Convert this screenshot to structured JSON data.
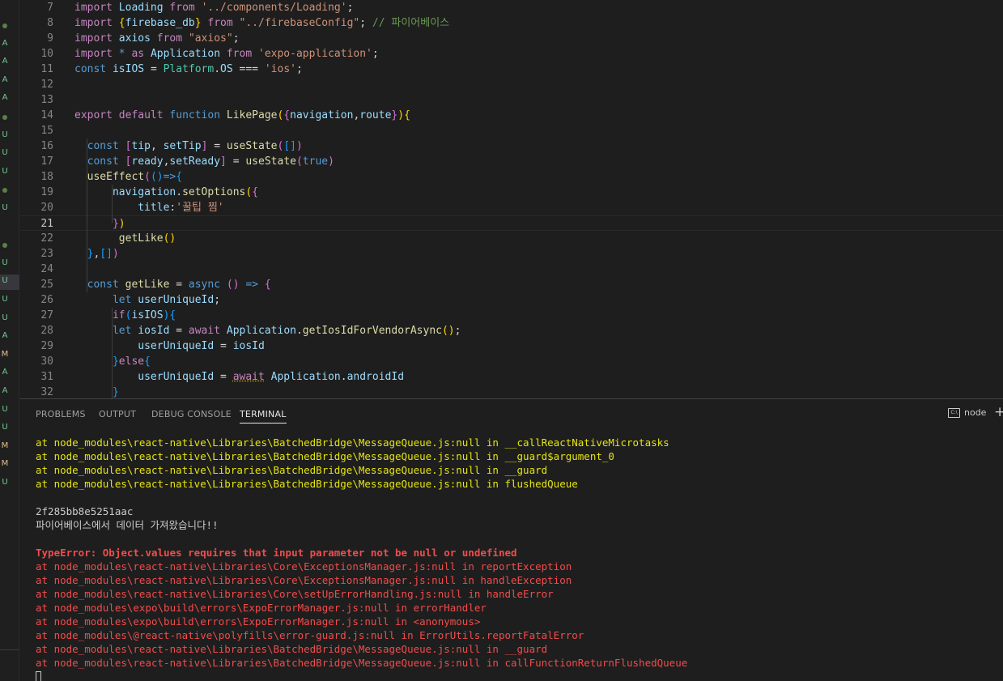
{
  "gutter": {
    "marks": [
      {
        "kind": "dot",
        "label": ""
      },
      {
        "kind": "letter",
        "label": "A"
      },
      {
        "kind": "letter",
        "label": "A"
      },
      {
        "kind": "letter",
        "label": "A"
      },
      {
        "kind": "letter",
        "label": "A"
      },
      {
        "kind": "dot",
        "label": ""
      },
      {
        "kind": "letter",
        "label": "U"
      },
      {
        "kind": "letter",
        "label": "U"
      },
      {
        "kind": "letter",
        "label": "U"
      },
      {
        "kind": "dot",
        "label": ""
      },
      {
        "kind": "letter",
        "label": "U"
      },
      {
        "kind": "blank",
        "label": ""
      },
      {
        "kind": "dot",
        "label": ""
      },
      {
        "kind": "letter",
        "label": "U"
      },
      {
        "kind": "letter",
        "label": "U"
      },
      {
        "kind": "letter",
        "label": "U"
      },
      {
        "kind": "letter",
        "label": "U"
      },
      {
        "kind": "letter",
        "label": "A"
      },
      {
        "kind": "letter",
        "label": "M"
      },
      {
        "kind": "letter",
        "label": "A"
      },
      {
        "kind": "letter",
        "label": "A"
      },
      {
        "kind": "letter",
        "label": "U"
      },
      {
        "kind": "letter",
        "label": "U"
      },
      {
        "kind": "letter",
        "label": "M"
      },
      {
        "kind": "letter",
        "label": "M"
      },
      {
        "kind": "letter",
        "label": "U"
      }
    ],
    "colors": {
      "A": "#73c991",
      "U": "#73c991",
      "M": "#e2c08d"
    }
  },
  "editor": {
    "active_line": 21,
    "lines": [
      {
        "n": "7",
        "tokens": [
          [
            "k",
            "import "
          ],
          [
            "v",
            "Loading "
          ],
          [
            "k",
            "from "
          ],
          [
            "s",
            "'../components/Loading'"
          ],
          [
            "p",
            ";"
          ]
        ]
      },
      {
        "n": "8",
        "tokens": [
          [
            "k",
            "import "
          ],
          [
            "y",
            "{"
          ],
          [
            "v",
            "firebase_db"
          ],
          [
            "y",
            "}"
          ],
          [
            "k",
            " from "
          ],
          [
            "s",
            "\"../firebaseConfig\""
          ],
          [
            "p",
            "; "
          ],
          [
            "c",
            "// 파이어베이스"
          ]
        ]
      },
      {
        "n": "9",
        "tokens": [
          [
            "k",
            "import "
          ],
          [
            "v",
            "axios "
          ],
          [
            "k",
            "from "
          ],
          [
            "s",
            "\"axios\""
          ],
          [
            "p",
            ";"
          ]
        ]
      },
      {
        "n": "10",
        "tokens": [
          [
            "k",
            "import "
          ],
          [
            "b",
            "* "
          ],
          [
            "k",
            "as "
          ],
          [
            "v",
            "Application "
          ],
          [
            "k",
            "from "
          ],
          [
            "s",
            "'expo-application'"
          ],
          [
            "p",
            ";"
          ]
        ]
      },
      {
        "n": "11",
        "tokens": [
          [
            "b",
            "const "
          ],
          [
            "v",
            "isIOS "
          ],
          [
            "p",
            "= "
          ],
          [
            "t",
            "Platform"
          ],
          [
            "p",
            "."
          ],
          [
            "v",
            "OS "
          ],
          [
            "p",
            "=== "
          ],
          [
            "s",
            "'ios'"
          ],
          [
            "p",
            ";"
          ]
        ]
      },
      {
        "n": "12",
        "tokens": []
      },
      {
        "n": "13",
        "tokens": []
      },
      {
        "n": "14",
        "tokens": [
          [
            "k",
            "export "
          ],
          [
            "k",
            "default "
          ],
          [
            "b",
            "function "
          ],
          [
            "f",
            "LikePage"
          ],
          [
            "y",
            "("
          ],
          [
            "pk",
            "{"
          ],
          [
            "v",
            "navigation"
          ],
          [
            "p",
            ","
          ],
          [
            "v",
            "route"
          ],
          [
            "pk",
            "}"
          ],
          [
            "y",
            ")"
          ],
          [
            "y",
            "{"
          ]
        ]
      },
      {
        "n": "15",
        "tokens": []
      },
      {
        "n": "16",
        "tokens": [
          [
            "p",
            "  "
          ],
          [
            "b",
            "const "
          ],
          [
            "pk",
            "["
          ],
          [
            "v",
            "tip"
          ],
          [
            "p",
            ", "
          ],
          [
            "v",
            "setTip"
          ],
          [
            "pk",
            "]"
          ],
          [
            "p",
            " = "
          ],
          [
            "f",
            "useState"
          ],
          [
            "pk",
            "("
          ],
          [
            "bl",
            "[]"
          ],
          [
            "pk",
            ")"
          ]
        ]
      },
      {
        "n": "17",
        "tokens": [
          [
            "p",
            "  "
          ],
          [
            "b",
            "const "
          ],
          [
            "pk",
            "["
          ],
          [
            "v",
            "ready"
          ],
          [
            "p",
            ","
          ],
          [
            "v",
            "setReady"
          ],
          [
            "pk",
            "]"
          ],
          [
            "p",
            " = "
          ],
          [
            "f",
            "useState"
          ],
          [
            "pk",
            "("
          ],
          [
            "b",
            "true"
          ],
          [
            "pk",
            ")"
          ]
        ]
      },
      {
        "n": "18",
        "tokens": [
          [
            "p",
            "  "
          ],
          [
            "f",
            "useEffect"
          ],
          [
            "pk",
            "("
          ],
          [
            "bl",
            "()"
          ],
          [
            "b",
            "=>"
          ],
          [
            "bl",
            "{"
          ]
        ]
      },
      {
        "n": "19",
        "tokens": [
          [
            "p",
            "      "
          ],
          [
            "v",
            "navigation"
          ],
          [
            "p",
            "."
          ],
          [
            "f",
            "setOptions"
          ],
          [
            "y",
            "("
          ],
          [
            "pk",
            "{"
          ]
        ]
      },
      {
        "n": "20",
        "tokens": [
          [
            "p",
            "          "
          ],
          [
            "v",
            "title"
          ],
          [
            "p",
            ":"
          ],
          [
            "s",
            "'꿀팁 찜'"
          ]
        ]
      },
      {
        "n": "21",
        "tokens": [
          [
            "p",
            "      "
          ],
          [
            "pk",
            "}"
          ],
          [
            "y",
            ")"
          ]
        ]
      },
      {
        "n": "22",
        "tokens": [
          [
            "p",
            "       "
          ],
          [
            "f",
            "getLike"
          ],
          [
            "y",
            "()"
          ]
        ]
      },
      {
        "n": "23",
        "tokens": [
          [
            "p",
            "  "
          ],
          [
            "bl",
            "}"
          ],
          [
            "p",
            ","
          ],
          [
            "bl",
            "[]"
          ],
          [
            "pk",
            ")"
          ]
        ]
      },
      {
        "n": "24",
        "tokens": []
      },
      {
        "n": "25",
        "tokens": [
          [
            "p",
            "  "
          ],
          [
            "b",
            "const "
          ],
          [
            "f",
            "getLike "
          ],
          [
            "p",
            "= "
          ],
          [
            "b",
            "async "
          ],
          [
            "pk",
            "()"
          ],
          [
            "b",
            " => "
          ],
          [
            "pk",
            "{"
          ]
        ]
      },
      {
        "n": "26",
        "tokens": [
          [
            "p",
            "      "
          ],
          [
            "b",
            "let "
          ],
          [
            "v",
            "userUniqueId"
          ],
          [
            "p",
            ";"
          ]
        ]
      },
      {
        "n": "27",
        "tokens": [
          [
            "p",
            "      "
          ],
          [
            "k",
            "if"
          ],
          [
            "bl",
            "("
          ],
          [
            "v",
            "isIOS"
          ],
          [
            "bl",
            ")"
          ],
          [
            "bl",
            "{"
          ]
        ]
      },
      {
        "n": "28",
        "tokens": [
          [
            "p",
            "      "
          ],
          [
            "b",
            "let "
          ],
          [
            "v",
            "iosId "
          ],
          [
            "p",
            "= "
          ],
          [
            "k",
            "await "
          ],
          [
            "v",
            "Application"
          ],
          [
            "p",
            "."
          ],
          [
            "f",
            "getIosIdForVendorAsync"
          ],
          [
            "y",
            "()"
          ],
          [
            "p",
            ";"
          ]
        ]
      },
      {
        "n": "29",
        "tokens": [
          [
            "p",
            "          "
          ],
          [
            "v",
            "userUniqueId "
          ],
          [
            "p",
            "= "
          ],
          [
            "v",
            "iosId"
          ]
        ]
      },
      {
        "n": "30",
        "tokens": [
          [
            "p",
            "      "
          ],
          [
            "bl",
            "}"
          ],
          [
            "k",
            "else"
          ],
          [
            "bl",
            "{"
          ]
        ]
      },
      {
        "n": "31",
        "tokens": [
          [
            "p",
            "          "
          ],
          [
            "v",
            "userUniqueId "
          ],
          [
            "p",
            "= "
          ],
          [
            "k~",
            "await"
          ],
          [
            "v",
            " Application"
          ],
          [
            "p",
            "."
          ],
          [
            "v",
            "androidId"
          ]
        ]
      },
      {
        "n": "32",
        "tokens": [
          [
            "p",
            "      "
          ],
          [
            "bl",
            "}"
          ]
        ]
      }
    ]
  },
  "panel": {
    "tabs": [
      "PROBLEMS",
      "OUTPUT",
      "DEBUG CONSOLE",
      "TERMINAL"
    ],
    "active_tab": "TERMINAL",
    "terminal_label": "node",
    "terminal_icon": "terminal-icon",
    "add_icon": "plus-icon"
  },
  "terminal": {
    "lines": [
      {
        "c": "yel",
        "t": "at node_modules\\react-native\\Libraries\\BatchedBridge\\MessageQueue.js:null in __callReactNativeMicrotasks"
      },
      {
        "c": "yel",
        "t": "at node_modules\\react-native\\Libraries\\BatchedBridge\\MessageQueue.js:null in __guard$argument_0"
      },
      {
        "c": "yel",
        "t": "at node_modules\\react-native\\Libraries\\BatchedBridge\\MessageQueue.js:null in __guard"
      },
      {
        "c": "yel",
        "t": "at node_modules\\react-native\\Libraries\\BatchedBridge\\MessageQueue.js:null in flushedQueue"
      },
      {
        "c": "white",
        "t": ""
      },
      {
        "c": "white",
        "t": "2f285bb8e5251aac"
      },
      {
        "c": "white",
        "t": "파이어베이스에서 데이터 가져왔습니다!!"
      },
      {
        "c": "white",
        "t": ""
      },
      {
        "c": "redb",
        "t": "TypeError: Object.values requires that input parameter not be null or undefined"
      },
      {
        "c": "red",
        "t": "at node_modules\\react-native\\Libraries\\Core\\ExceptionsManager.js:null in reportException"
      },
      {
        "c": "red",
        "t": "at node_modules\\react-native\\Libraries\\Core\\ExceptionsManager.js:null in handleException"
      },
      {
        "c": "red",
        "t": "at node_modules\\react-native\\Libraries\\Core\\setUpErrorHandling.js:null in handleError"
      },
      {
        "c": "red",
        "t": "at node_modules\\expo\\build\\errors\\ExpoErrorManager.js:null in errorHandler"
      },
      {
        "c": "red",
        "t": "at node_modules\\expo\\build\\errors\\ExpoErrorManager.js:null in <anonymous>"
      },
      {
        "c": "red",
        "t": "at node_modules\\@react-native\\polyfills\\error-guard.js:null in ErrorUtils.reportFatalError"
      },
      {
        "c": "red",
        "t": "at node_modules\\react-native\\Libraries\\BatchedBridge\\MessageQueue.js:null in __guard"
      },
      {
        "c": "red",
        "t": "at node_modules\\react-native\\Libraries\\BatchedBridge\\MessageQueue.js:null in callFunctionReturnFlushedQueue"
      }
    ]
  }
}
